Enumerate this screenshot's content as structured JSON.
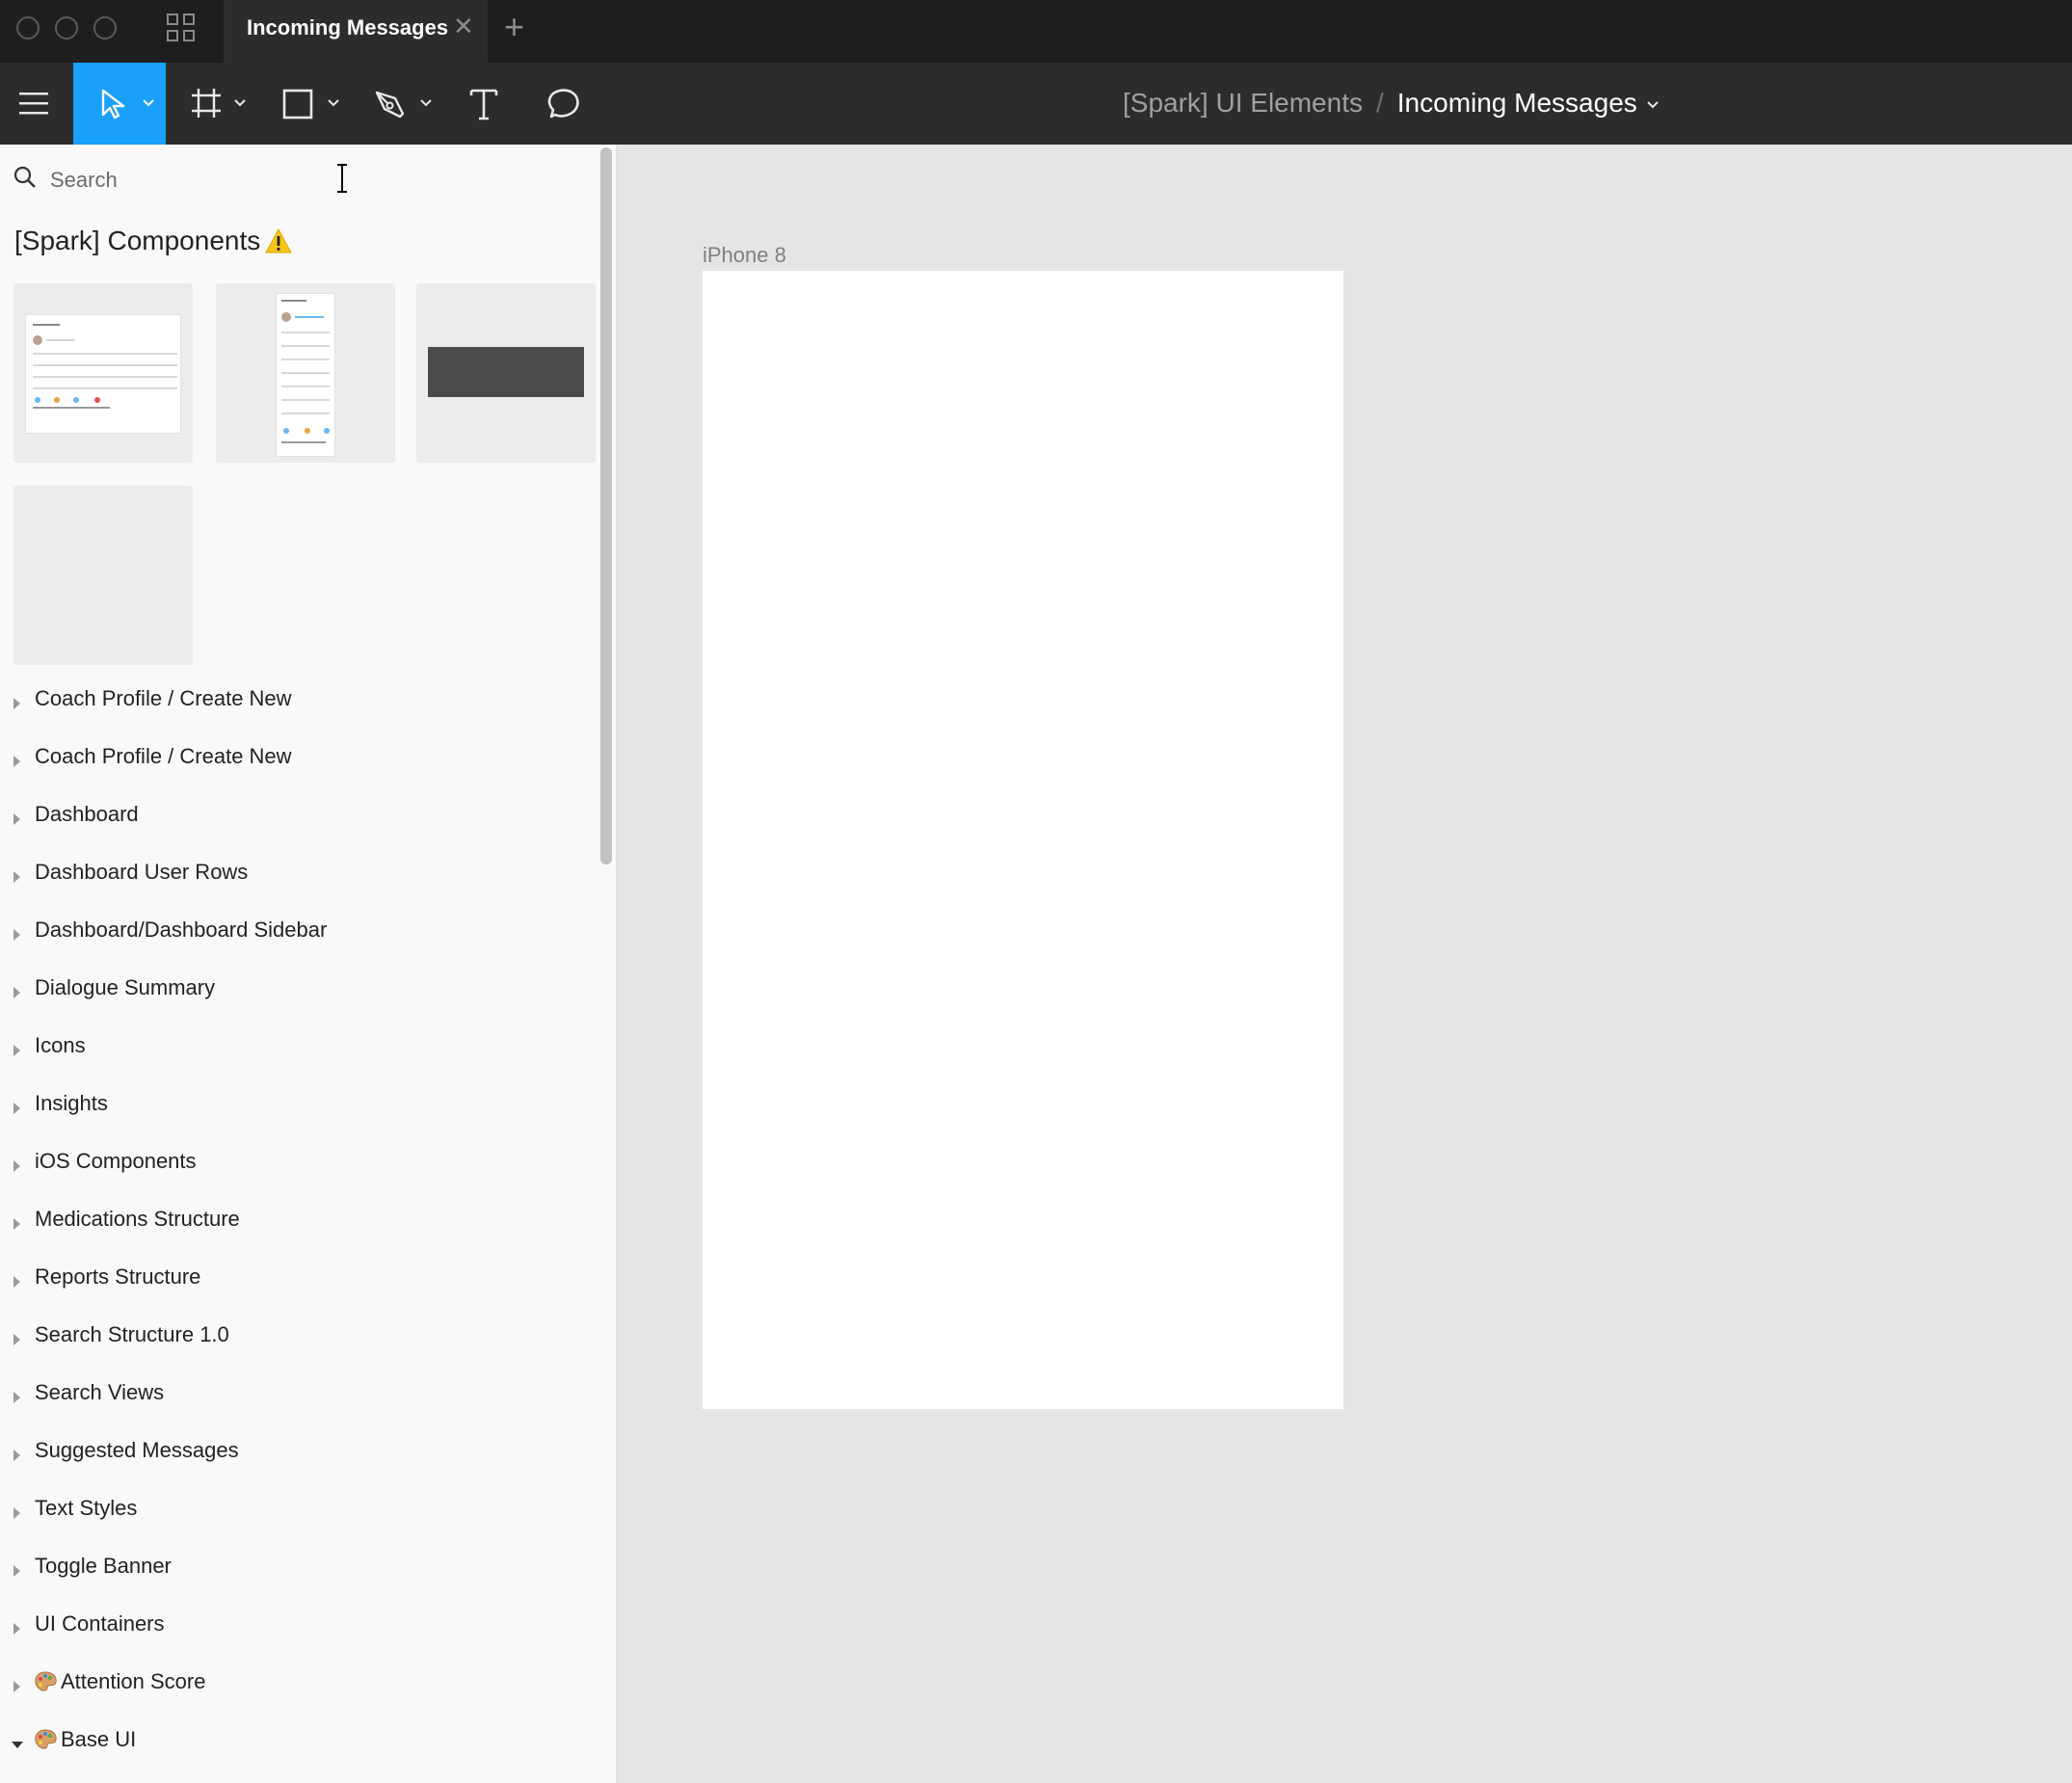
{
  "titlebar": {
    "tab_label": "Incoming Messages",
    "tab_close": "✕",
    "new_tab": "+"
  },
  "toolbar": {
    "tools": [
      "menu-icon",
      "move-tool",
      "frame-tool",
      "rectangle-tool",
      "pen-tool",
      "text-tool",
      "comment-tool"
    ],
    "active_tool": "move-tool",
    "active_color": "#18a0fb",
    "breadcrumb": {
      "file": "[Spark] UI Elements",
      "separator": "/",
      "page": "Incoming Messages"
    }
  },
  "panel": {
    "search_placeholder": "Search",
    "library_title": "[Spark] Components",
    "items": [
      {
        "label": "Coach Profile / Create New"
      },
      {
        "label": "Coach Profile / Create New"
      },
      {
        "label": "Dashboard"
      },
      {
        "label": "Dashboard User Rows"
      },
      {
        "label": "Dashboard/Dashboard Sidebar"
      },
      {
        "label": "Dialogue Summary"
      },
      {
        "label": "Icons"
      },
      {
        "label": "Insights"
      },
      {
        "label": "iOS Components"
      },
      {
        "label": "Medications Structure"
      },
      {
        "label": "Reports Structure"
      },
      {
        "label": "Search Structure 1.0"
      },
      {
        "label": "Search Views"
      },
      {
        "label": "Suggested Messages"
      },
      {
        "label": "Text Styles"
      },
      {
        "label": "Toggle Banner"
      },
      {
        "label": "UI Containers"
      },
      {
        "label": "Attention Score"
      },
      {
        "label": "Base UI"
      }
    ]
  },
  "canvas": {
    "frame_label": "iPhone 8",
    "background": "#e5e5e5"
  }
}
